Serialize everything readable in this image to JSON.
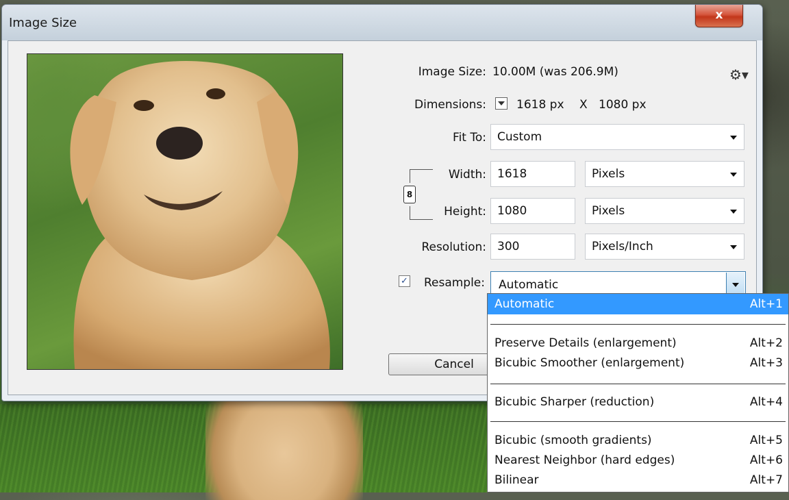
{
  "window": {
    "title": "Image Size",
    "close_label": "x"
  },
  "summary": {
    "image_size_label": "Image Size:",
    "image_size_value": "10.00M (was 206.9M)",
    "dimensions_label": "Dimensions:",
    "dimensions_width": "1618 px",
    "dimensions_sep": "X",
    "dimensions_height": "1080 px",
    "settings_icon": "gear-icon"
  },
  "form": {
    "fit_to_label": "Fit To:",
    "fit_to_value": "Custom",
    "width_label": "Width:",
    "width_value": "1618",
    "width_unit": "Pixels",
    "height_label": "Height:",
    "height_value": "1080",
    "height_unit": "Pixels",
    "resolution_label": "Resolution:",
    "resolution_value": "300",
    "resolution_unit": "Pixels/Inch",
    "resample_label": "Resample:",
    "resample_checked": true,
    "resample_value": "Automatic",
    "cancel_label": "Cancel"
  },
  "dropdown": {
    "options": [
      {
        "name": "Automatic",
        "shortcut": "Alt+1",
        "selected": true
      },
      {
        "name": "Preserve Details (enlargement)",
        "shortcut": "Alt+2"
      },
      {
        "name": "Bicubic Smoother (enlargement)",
        "shortcut": "Alt+3"
      },
      {
        "name": "Bicubic Sharper (reduction)",
        "shortcut": "Alt+4"
      },
      {
        "name": "Bicubic (smooth gradients)",
        "shortcut": "Alt+5"
      },
      {
        "name": "Nearest Neighbor (hard edges)",
        "shortcut": "Alt+6"
      },
      {
        "name": "Bilinear",
        "shortcut": "Alt+7"
      }
    ]
  },
  "colors": {
    "highlight": "#3399ff",
    "close_button": "#c2361b"
  }
}
